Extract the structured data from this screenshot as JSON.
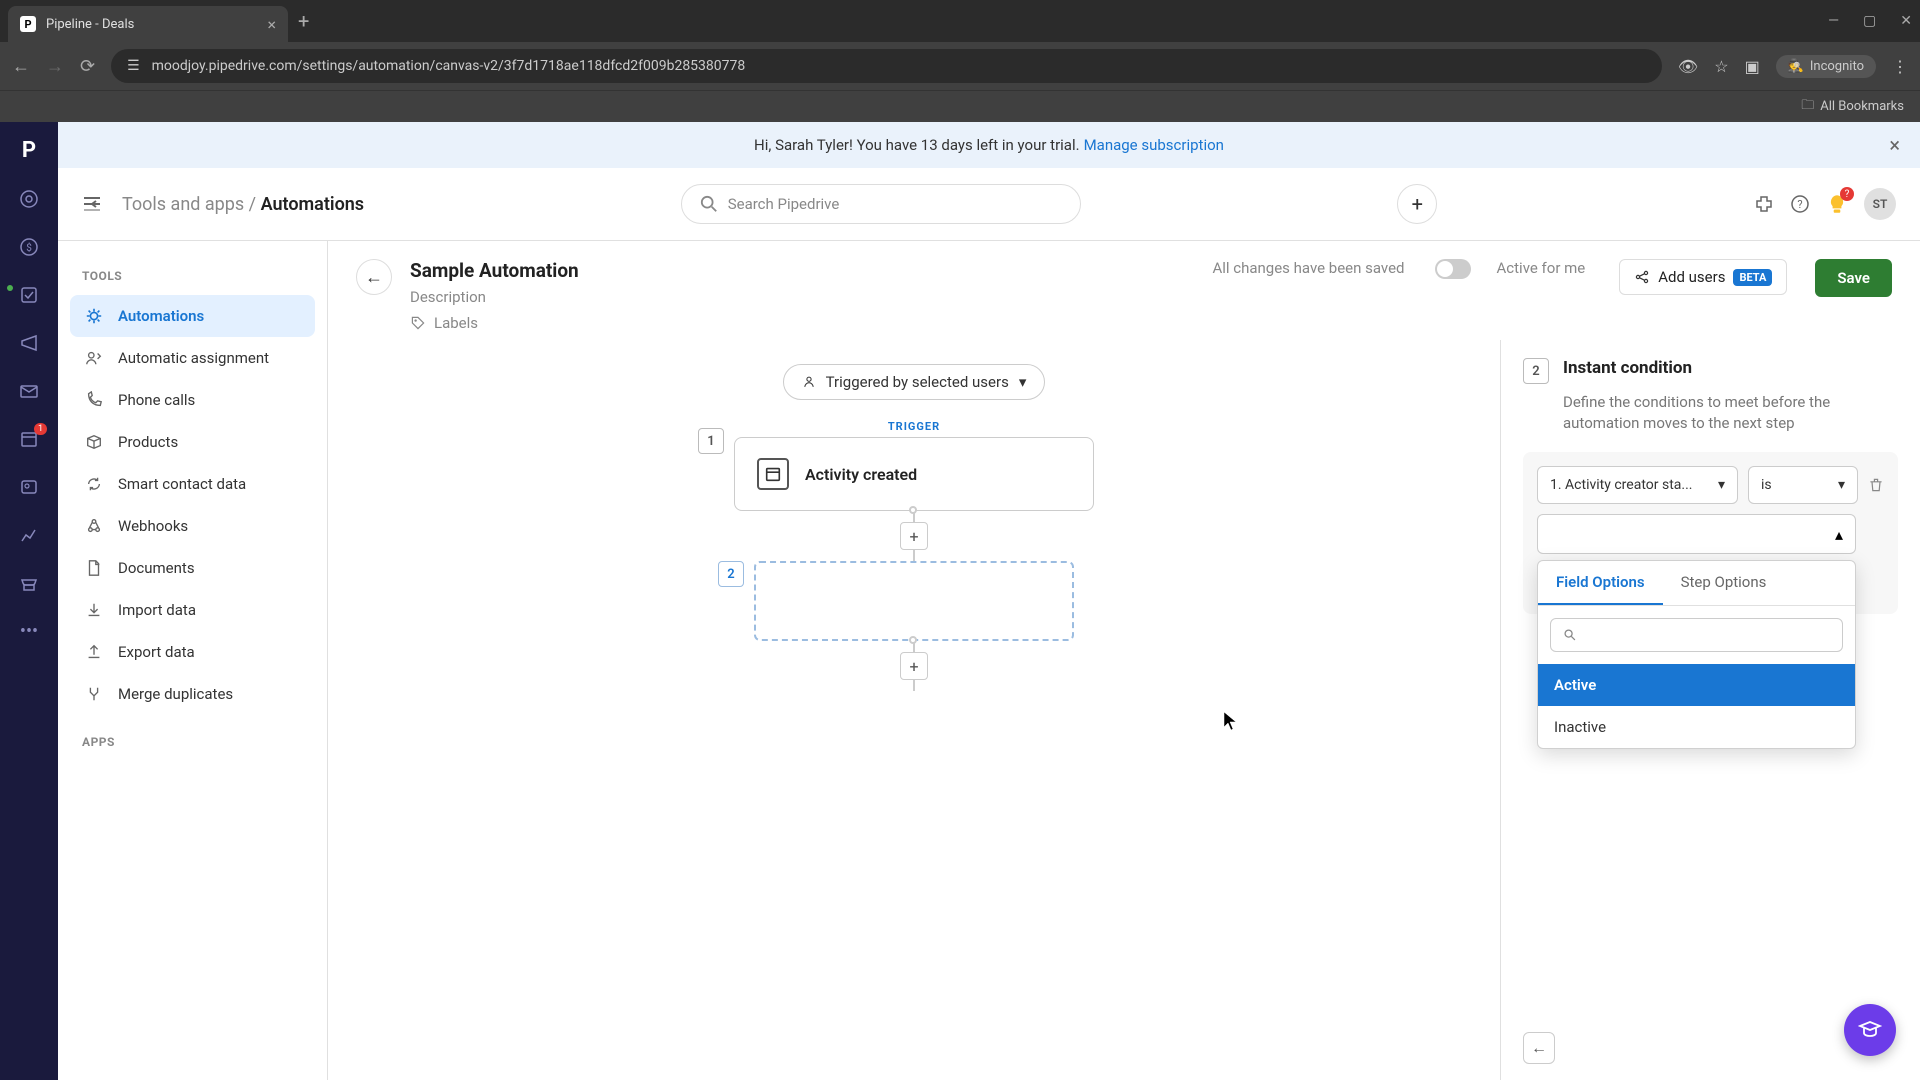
{
  "browser": {
    "tab_title": "Pipeline - Deals",
    "url": "moodjoy.pipedrive.com/settings/automation/canvas-v2/3f7d1718ae118dfcd2f009b285380778",
    "incognito_label": "Incognito",
    "bookmarks_label": "All Bookmarks"
  },
  "trial_banner": {
    "text": "Hi, Sarah Tyler! You have 13 days left in your trial.",
    "link": "Manage subscription"
  },
  "header": {
    "breadcrumb_root": "Tools and apps",
    "breadcrumb_current": "Automations",
    "search_placeholder": "Search Pipedrive",
    "avatar_initials": "ST",
    "bulb_badge": "?"
  },
  "sidebar": {
    "tools_heading": "TOOLS",
    "apps_heading": "APPS",
    "items": [
      {
        "label": "Automations"
      },
      {
        "label": "Automatic assignment"
      },
      {
        "label": "Phone calls"
      },
      {
        "label": "Products"
      },
      {
        "label": "Smart contact data"
      },
      {
        "label": "Webhooks"
      },
      {
        "label": "Documents"
      },
      {
        "label": "Import data"
      },
      {
        "label": "Export data"
      },
      {
        "label": "Merge duplicates"
      }
    ]
  },
  "canvas": {
    "title": "Sample Automation",
    "description": "Description",
    "labels": "Labels",
    "save_status": "All changes have been saved",
    "toggle_label": "Active for me",
    "add_users": "Add users",
    "beta": "BETA",
    "save": "Save",
    "trigger_chip": "Triggered by selected users",
    "trigger_label": "TRIGGER",
    "node1_title": "Activity created",
    "node1_number": "1",
    "node2_number": "2"
  },
  "panel": {
    "number": "2",
    "title": "Instant condition",
    "description": "Define the conditions to meet before the automation moves to the next step",
    "field_select": "1. Activity creator sta...",
    "operator_select": "is",
    "tabs": {
      "field": "Field Options",
      "step": "Step Options"
    },
    "options": [
      {
        "label": "Active"
      },
      {
        "label": "Inactive"
      }
    ]
  },
  "rail_badge": "1"
}
